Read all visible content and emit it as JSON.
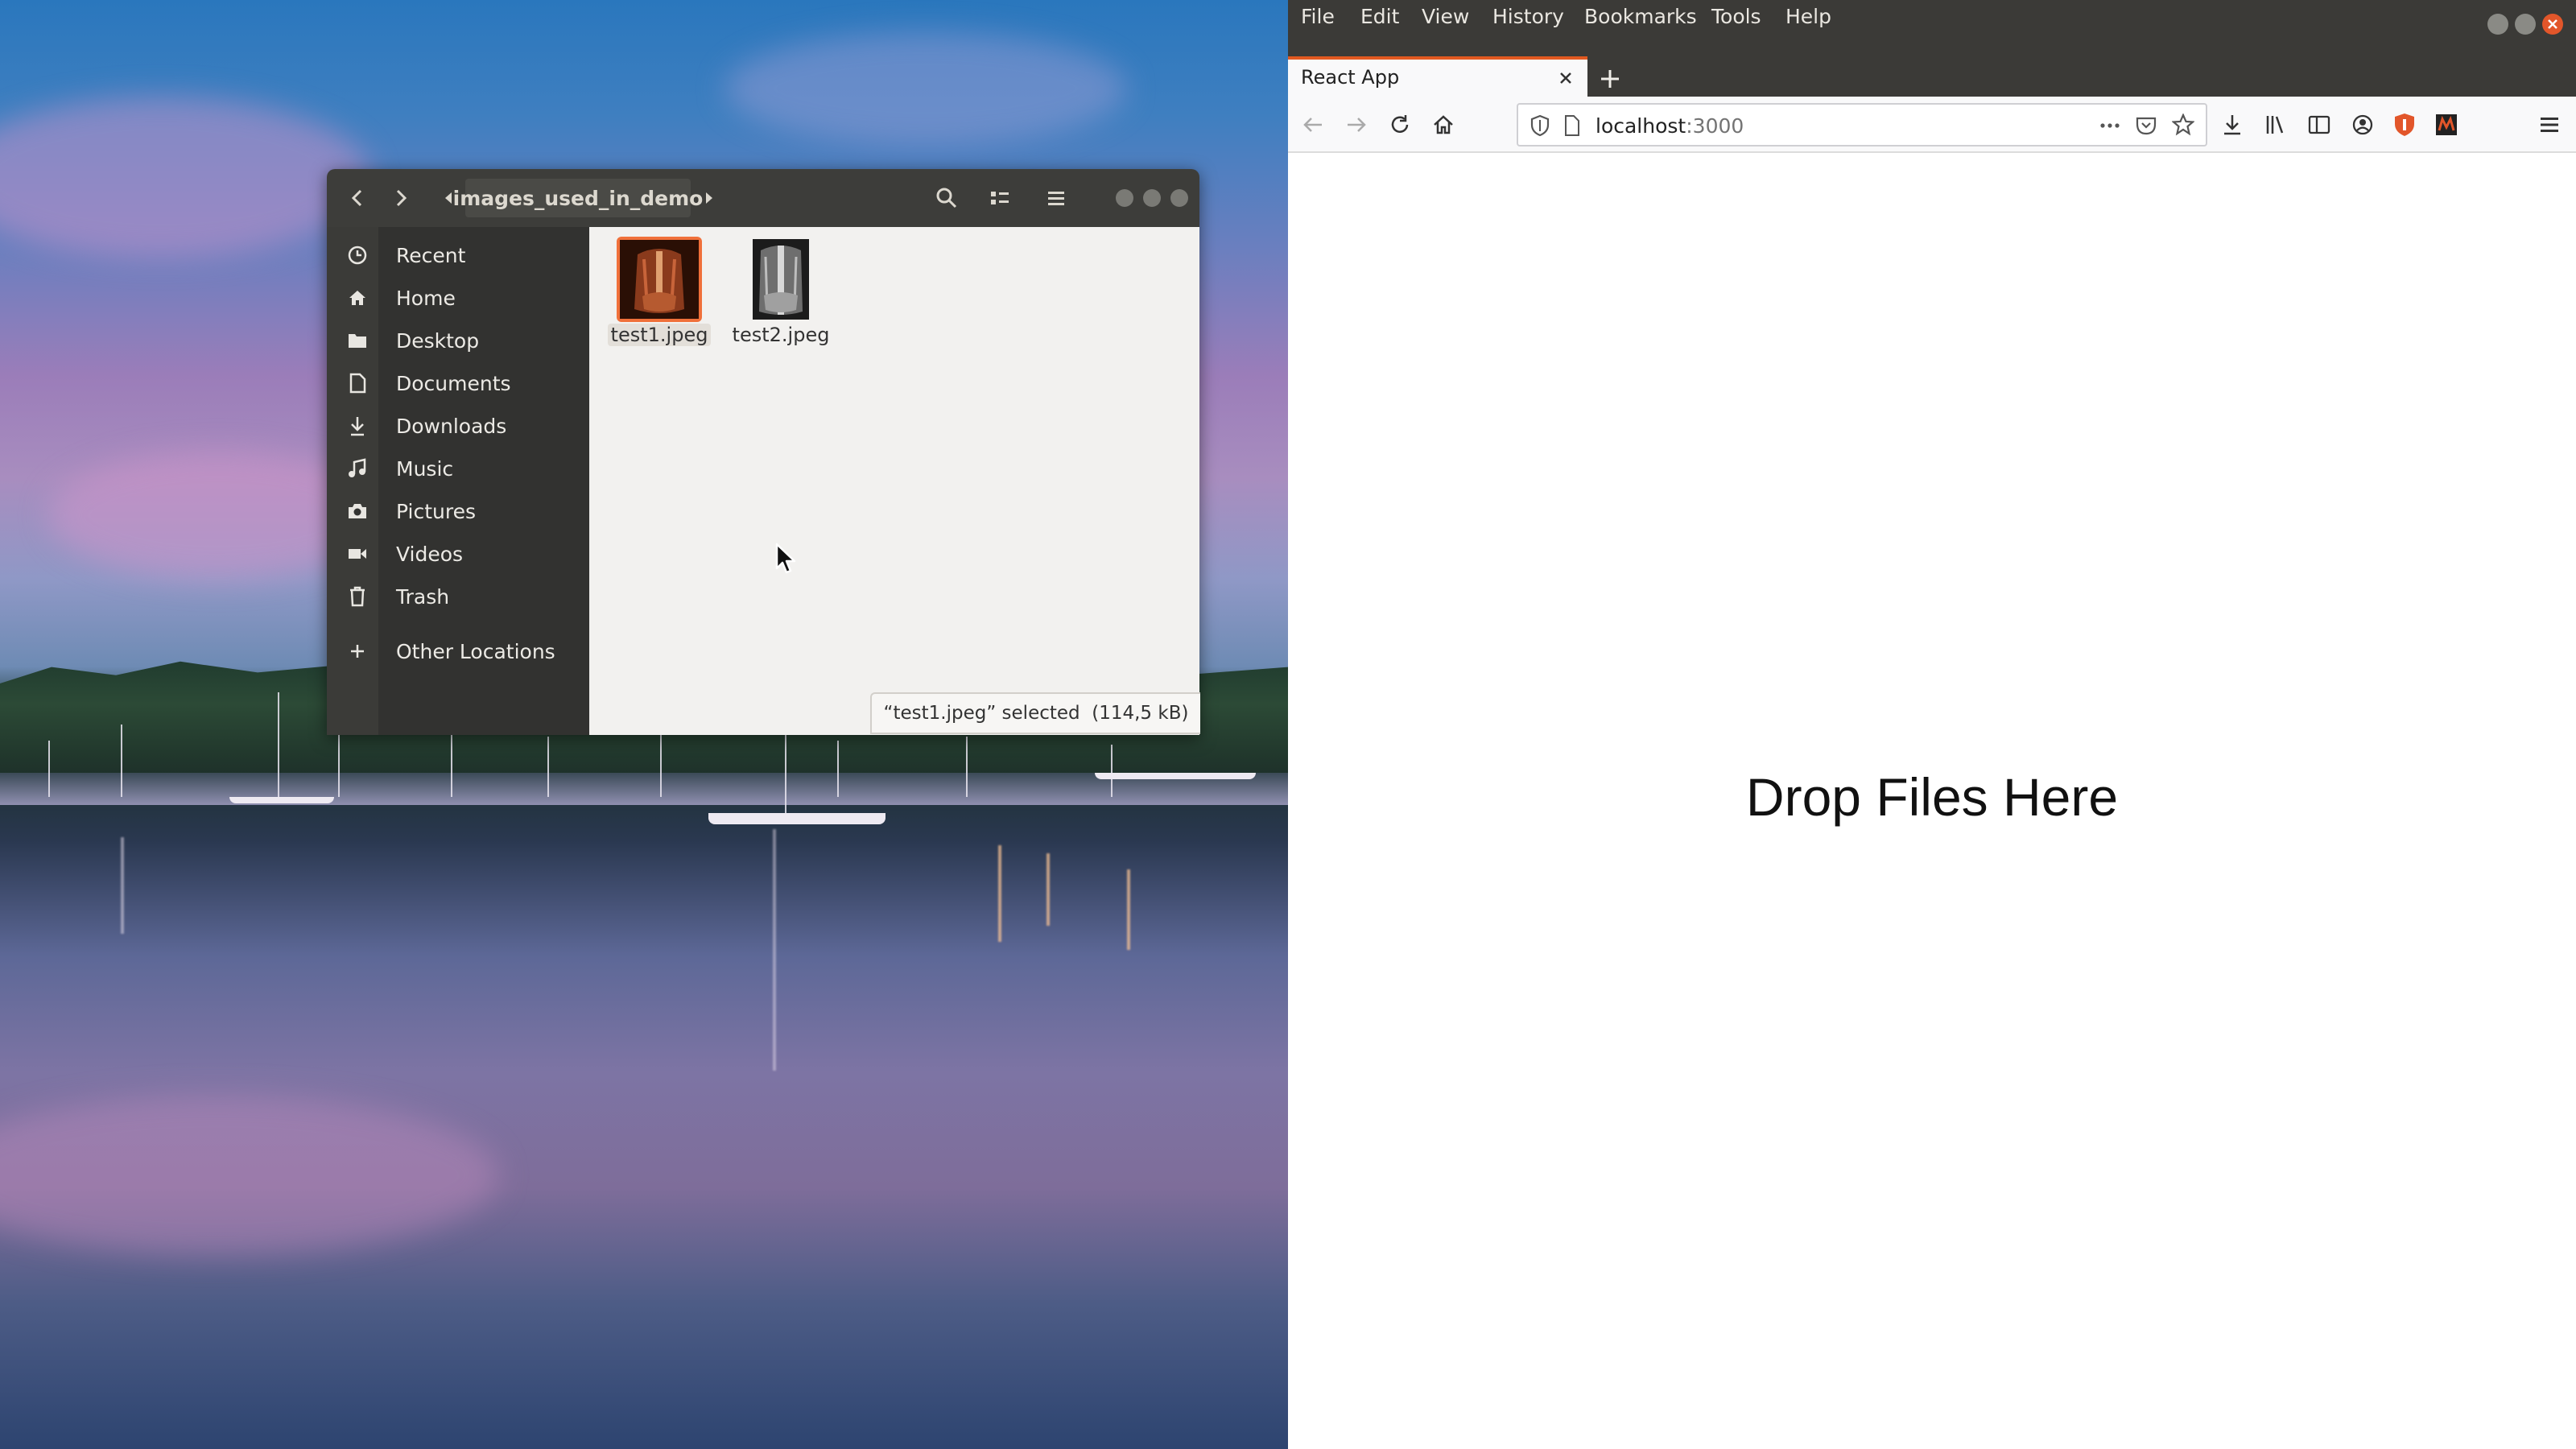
{
  "files_window": {
    "path_segment": "images_used_in_demo",
    "sidebar": [
      {
        "icon": "clock-icon",
        "label": "Recent"
      },
      {
        "icon": "home-icon",
        "label": "Home"
      },
      {
        "icon": "folder-icon",
        "label": "Desktop"
      },
      {
        "icon": "document-icon",
        "label": "Documents"
      },
      {
        "icon": "download-icon",
        "label": "Downloads"
      },
      {
        "icon": "music-icon",
        "label": "Music"
      },
      {
        "icon": "camera-icon",
        "label": "Pictures"
      },
      {
        "icon": "video-icon",
        "label": "Videos"
      },
      {
        "icon": "trash-icon",
        "label": "Trash"
      },
      {
        "icon": "plus-icon",
        "label": "Other Locations"
      }
    ],
    "files": [
      {
        "name": "test1.jpeg",
        "selected": true
      },
      {
        "name": "test2.jpeg",
        "selected": false
      }
    ],
    "status": "“test1.jpeg” selected  (114,5 kB)"
  },
  "browser": {
    "menu": [
      "File",
      "Edit",
      "View",
      "History",
      "Bookmarks",
      "Tools",
      "Help"
    ],
    "tab_title": "React App",
    "url_host": "localhost",
    "url_port": ":3000",
    "page_text": "Drop Files Here",
    "accent_color": "#e25920"
  }
}
